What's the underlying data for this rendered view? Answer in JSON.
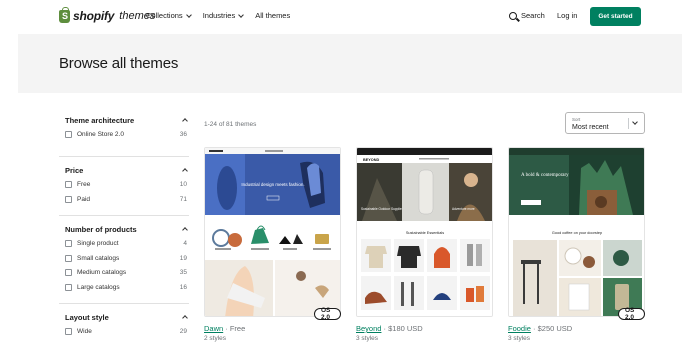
{
  "header": {
    "logo_word": "shopify",
    "logo_suffix": "themes",
    "nav": [
      {
        "label": "Collections",
        "has_dropdown": true
      },
      {
        "label": "Industries",
        "has_dropdown": true
      },
      {
        "label": "All themes",
        "has_dropdown": false
      }
    ],
    "search_label": "Search",
    "login_label": "Log in",
    "cta_label": "Get started",
    "colors": {
      "brand": "#008060",
      "logo_green": "#5e8e3e"
    }
  },
  "hero": {
    "title": "Browse all themes"
  },
  "results": {
    "count_text": "1-24 of 81 themes"
  },
  "sort": {
    "label": "Sort",
    "value": "Most recent"
  },
  "filters": [
    {
      "title": "Theme architecture",
      "options": [
        {
          "label": "Online Store 2.0",
          "count": "36"
        }
      ]
    },
    {
      "title": "Price",
      "options": [
        {
          "label": "Free",
          "count": "10"
        },
        {
          "label": "Paid",
          "count": "71"
        }
      ]
    },
    {
      "title": "Number of products",
      "options": [
        {
          "label": "Single product",
          "count": "4"
        },
        {
          "label": "Small catalogs",
          "count": "19"
        },
        {
          "label": "Medium catalogs",
          "count": "35"
        },
        {
          "label": "Large catalogs",
          "count": "16"
        }
      ]
    },
    {
      "title": "Layout style",
      "options": [
        {
          "label": "Wide",
          "count": "29"
        }
      ]
    }
  ],
  "themes": [
    {
      "name": "Dawn",
      "price": " · Free",
      "styles": "2 styles",
      "badge": "OS 2.0"
    },
    {
      "name": "Beyond",
      "price": " · $180 USD",
      "styles": "3 styles",
      "badge": ""
    },
    {
      "name": "Foodie",
      "price": " · $250 USD",
      "styles": "3 styles",
      "badge": "OS 2.0"
    }
  ],
  "preview_text": {
    "dawn_hero": "Industrial design meets fashion.",
    "beyond_hero_left": "Sustainable Outdoor Supplies",
    "beyond_hero_right": "Adventure more",
    "beyond_section": "Sustainable Essentials",
    "beyond_brand": "BEYOND",
    "foodie_hero": "A bold & contemporary choice",
    "foodie_section": "Good coffee on your doorstep"
  }
}
